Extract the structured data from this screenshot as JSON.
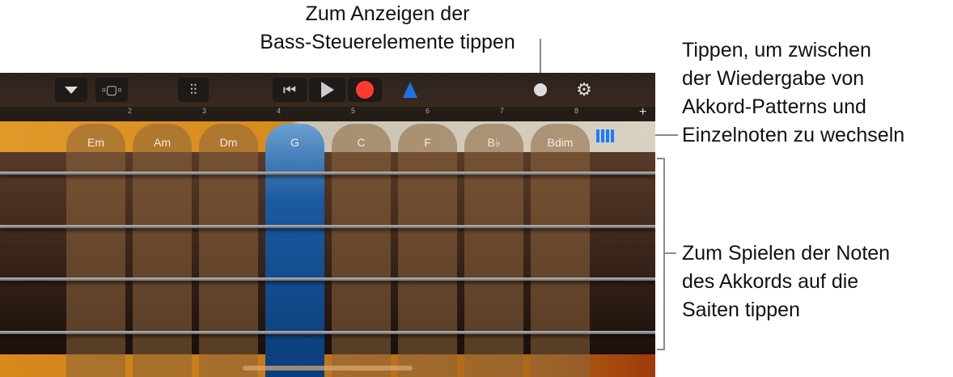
{
  "callouts": {
    "bass_controls": [
      "Zum Anzeigen der",
      "Bass-Steuerelemente tippen"
    ],
    "toggle": [
      "Tippen, um zwischen",
      "der Wiedergabe von",
      "Akkord-Patterns und",
      "Einzelnoten zu wechseln"
    ],
    "strings": [
      "Zum Spielen der Noten",
      "des Akkords auf die",
      "Saiten tippen"
    ]
  },
  "ruler": {
    "numbers": [
      "2",
      "3",
      "4",
      "5",
      "6",
      "7",
      "8"
    ],
    "add": "+"
  },
  "chords": [
    "Em",
    "Am",
    "Dm",
    "G",
    "C",
    "F",
    "B♭",
    "Bdim"
  ],
  "selected_chord": "G",
  "colors": {
    "accent": "#1a7cff",
    "record": "#ff3b30"
  }
}
